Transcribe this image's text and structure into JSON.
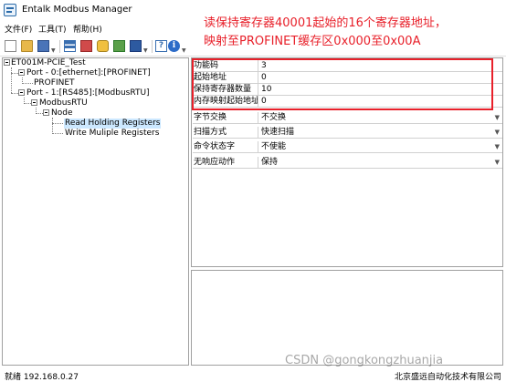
{
  "window": {
    "title": "Entalk Modbus Manager",
    "app_icon": "modbus-app-icon"
  },
  "menu": [
    "文件(F)",
    "工具(T)",
    "帮助(H)"
  ],
  "toolbar": {
    "icons": [
      "new-file-icon",
      "open-folder-icon",
      "save-icon",
      "grid-icon",
      "delete-icon",
      "settings-icon",
      "add-icon",
      "export-icon",
      "help-icon",
      "info-icon"
    ],
    "help_glyph": "?",
    "info_glyph": "i"
  },
  "tree": {
    "root": "ET001M-PCIE_Test",
    "port0": "Port - 0:[ethernet]:[PROFINET]",
    "profinet": "PROFINET",
    "port1": "Port - 1:[RS485]:[ModbusRTU]",
    "modbusrtu": "ModbusRTU",
    "node": "Node",
    "read_holding": "Read Holding Registers",
    "write_multiple": "Write Muliple Registers"
  },
  "properties": [
    {
      "label": "功能码",
      "value": "3",
      "type": "text"
    },
    {
      "label": "起始地址",
      "value": "0",
      "type": "text"
    },
    {
      "label": "保持寄存器数量",
      "value": "10",
      "type": "text"
    },
    {
      "label": "内存映射起始地址",
      "value": "0",
      "type": "text"
    },
    {
      "label": "字节交换",
      "value": "不交换",
      "type": "dropdown"
    },
    {
      "label": "扫描方式",
      "value": "快速扫描",
      "type": "dropdown"
    },
    {
      "label": "命令状态字",
      "value": "不使能",
      "type": "dropdown"
    },
    {
      "label": "无响应动作",
      "value": "保持",
      "type": "dropdown"
    }
  ],
  "dropdown_arrow": "▼",
  "annotation": {
    "line1": "读保持寄存器40001起始的16个寄存器地址，",
    "line2": "映射至PROFINET缓存区0x000至0x00A",
    "color": "#e8202a"
  },
  "status": {
    "left": "就绪  192.168.0.27",
    "right": "北京盛远自动化技术有限公司"
  },
  "watermark": "CSDN @gongkongzhuanjia"
}
